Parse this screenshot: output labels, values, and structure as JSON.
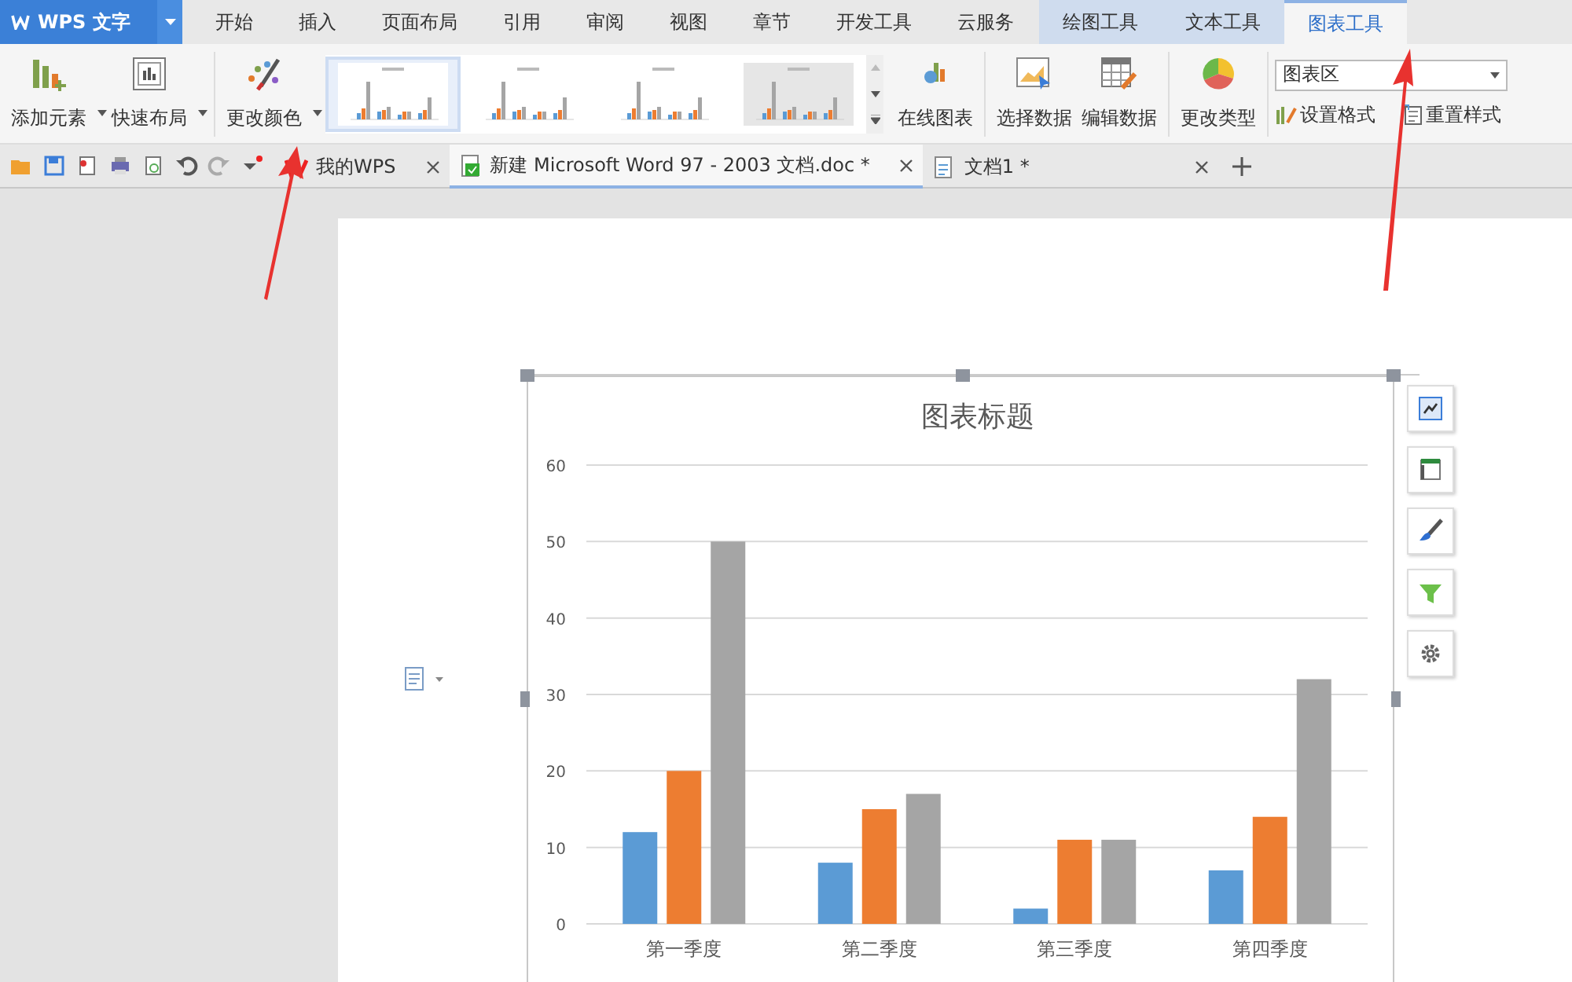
{
  "app_menu": {
    "label": "WPS 文字"
  },
  "tabs": [
    {
      "label": "开始",
      "kind": "normal",
      "selected": false
    },
    {
      "label": "插入",
      "kind": "normal",
      "selected": false
    },
    {
      "label": "页面布局",
      "kind": "normal",
      "selected": false
    },
    {
      "label": "引用",
      "kind": "normal",
      "selected": false
    },
    {
      "label": "审阅",
      "kind": "normal",
      "selected": false
    },
    {
      "label": "视图",
      "kind": "normal",
      "selected": false
    },
    {
      "label": "章节",
      "kind": "normal",
      "selected": false
    },
    {
      "label": "开发工具",
      "kind": "normal",
      "selected": false
    },
    {
      "label": "云服务",
      "kind": "normal",
      "selected": false
    },
    {
      "label": "绘图工具",
      "kind": "context",
      "selected": false
    },
    {
      "label": "文本工具",
      "kind": "context",
      "selected": false
    },
    {
      "label": "图表工具",
      "kind": "context",
      "selected": true
    }
  ],
  "ribbon": {
    "add_element": "添加元素",
    "quick_layout": "快速布局",
    "change_color": "更改颜色",
    "styles": [
      {
        "selected": true
      },
      {
        "selected": false
      },
      {
        "selected": false
      },
      {
        "selected": false
      }
    ],
    "online_chart": "在线图表",
    "select_data": "选择数据",
    "edit_data": "编辑数据",
    "change_type": "更改类型",
    "element_dropdown": "图表区",
    "format": "设置格式",
    "reset_style": "重置样式"
  },
  "doc_tabs": [
    {
      "label": "我的WPS",
      "selected": false
    },
    {
      "label": "新建 Microsoft Word 97 - 2003 文档.doc *",
      "selected": true
    },
    {
      "label": "文档1 *",
      "selected": false
    }
  ],
  "chart": {
    "chart_data": {
      "type": "bar",
      "title": "图表标题",
      "categories": [
        "第一季度",
        "第二季度",
        "第三季度",
        "第四季度"
      ],
      "series": [
        {
          "color": "#5b9bd5",
          "values": [
            12,
            8,
            2,
            7
          ]
        },
        {
          "color": "#ed7d31",
          "values": [
            20,
            15,
            11,
            14
          ]
        },
        {
          "color": "#a5a5a5",
          "values": [
            50,
            17,
            11,
            32
          ]
        }
      ],
      "ylim": [
        0,
        60
      ],
      "grid": true,
      "yticks": [
        0,
        10,
        20,
        30,
        40,
        50,
        60
      ]
    }
  }
}
